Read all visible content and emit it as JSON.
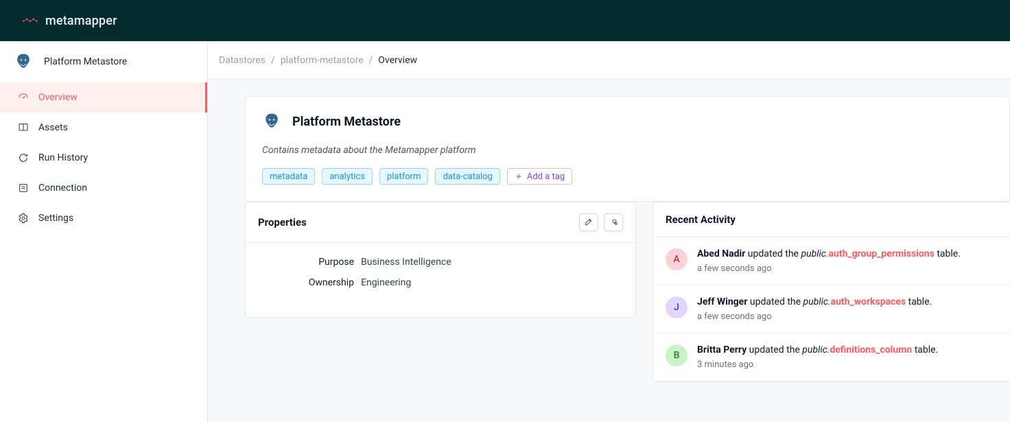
{
  "brand": {
    "name": "metamapper"
  },
  "sidebar": {
    "title": "Platform Metastore",
    "items": [
      {
        "icon": "overview-icon",
        "label": "Overview",
        "active": true
      },
      {
        "icon": "assets-icon",
        "label": "Assets"
      },
      {
        "icon": "run-history-icon",
        "label": "Run History"
      },
      {
        "icon": "connection-icon",
        "label": "Connection"
      },
      {
        "icon": "settings-icon",
        "label": "Settings"
      }
    ]
  },
  "breadcrumbs": {
    "items": [
      {
        "label": "Datastores",
        "current": false
      },
      {
        "label": "platform-metastore",
        "current": false
      },
      {
        "label": "Overview",
        "current": true
      }
    ]
  },
  "hero": {
    "title": "Platform Metastore",
    "description": "Contains metadata about the Metamapper platform",
    "tags": [
      "metadata",
      "analytics",
      "platform",
      "data-catalog"
    ],
    "addTagLabel": "Add a tag"
  },
  "properties": {
    "title": "Properties",
    "rows": [
      {
        "label": "Purpose",
        "value": "Business Intelligence"
      },
      {
        "label": "Ownership",
        "value": "Engineering"
      }
    ]
  },
  "activity": {
    "title": "Recent Activity",
    "items": [
      {
        "initial": "A",
        "avatarClass": "pink",
        "actor": "Abed Nadir",
        "action": "updated the",
        "schema": "public.",
        "object": "auth_group_permissions",
        "suffix": "table.",
        "time": "a few seconds ago"
      },
      {
        "initial": "J",
        "avatarClass": "purple",
        "actor": "Jeff Winger",
        "action": "updated the",
        "schema": "public.",
        "object": "auth_workspaces",
        "suffix": "table.",
        "time": "a few seconds ago"
      },
      {
        "initial": "B",
        "avatarClass": "green",
        "actor": "Britta Perry",
        "action": "updated the",
        "schema": "public.",
        "object": "definitions_column",
        "suffix": "table.",
        "time": "3 minutes ago"
      }
    ]
  }
}
